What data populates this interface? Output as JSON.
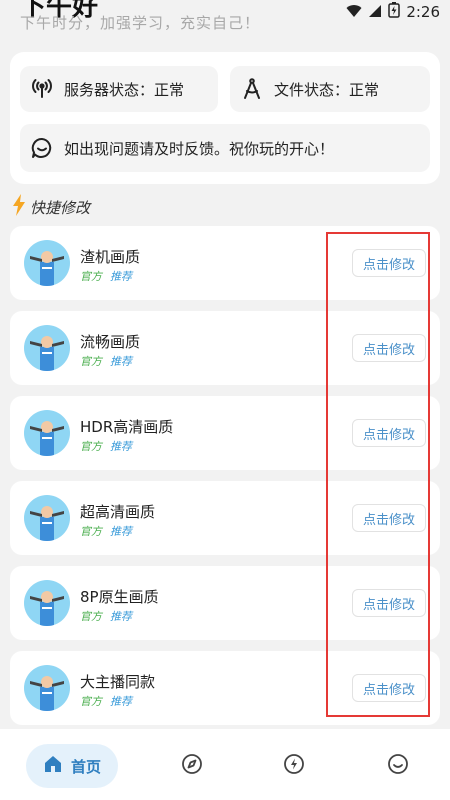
{
  "status_bar": {
    "time": "2:26"
  },
  "greeting": {
    "title": "下午好",
    "subtitle": "下午时分，加强学习，充实自己！"
  },
  "info": {
    "server_status": "服务器状态：正常",
    "file_status": "文件状态：正常",
    "feedback": "如出现问题请及时反馈。祝你玩的开心！"
  },
  "section": {
    "title": "快捷修改"
  },
  "items": [
    {
      "name": "渣机画质",
      "tag1": "官方",
      "tag2": "推荐",
      "button": "点击修改"
    },
    {
      "name": "流畅画质",
      "tag1": "官方",
      "tag2": "推荐",
      "button": "点击修改"
    },
    {
      "name": "HDR高清画质",
      "tag1": "官方",
      "tag2": "推荐",
      "button": "点击修改"
    },
    {
      "name": "超高清画质",
      "tag1": "官方",
      "tag2": "推荐",
      "button": "点击修改"
    },
    {
      "name": "8P原生画质",
      "tag1": "官方",
      "tag2": "推荐",
      "button": "点击修改"
    },
    {
      "name": "大主播同款",
      "tag1": "官方",
      "tag2": "推荐",
      "button": "点击修改"
    }
  ],
  "tabs": {
    "home": "首页"
  },
  "icons": {
    "server": "broadcast-icon",
    "file": "compass-draw-icon",
    "feedback": "chat-bubble-icon",
    "section": "lightning-icon",
    "tabs": [
      "home-icon",
      "compass-icon",
      "flash-icon",
      "smile-icon"
    ]
  },
  "colors": {
    "accent": "#2f7fc0",
    "official": "#4caf50",
    "recommend": "#3a9bd9",
    "highlight": "#e53935"
  }
}
